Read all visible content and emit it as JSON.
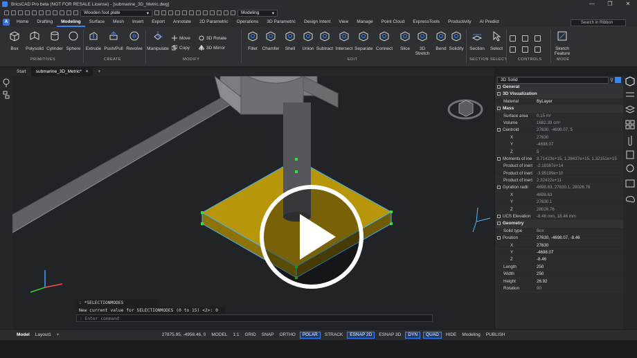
{
  "window": {
    "title": "BricsCAD Pro beta (NOT FOR RESALE License) - [submarine_3D_Metric.dwg]",
    "controls": [
      "—",
      "❐",
      "✕"
    ]
  },
  "qat": {
    "layer_value": "Wooden foot plate",
    "workspace_value": "Modeling"
  },
  "menu": {
    "app_button": "A",
    "items": [
      "Home",
      "Drafting",
      "Modeling",
      "Surface",
      "Mesh",
      "Insert",
      "Export",
      "Annotate",
      "2D Parametric",
      "Operations",
      "3D Parametric",
      "Design Intent",
      "View",
      "Manage",
      "Point Cloud",
      "ExpressTools",
      "Productivity",
      "AI Predict"
    ],
    "active": "Modeling",
    "search_placeholder": "Search in Ribbon"
  },
  "ribbon": {
    "primitives": [
      "Box",
      "Polysolid",
      "Cylinder",
      "Sphere"
    ],
    "create": [
      "Extrude",
      "Push/Pull",
      "Revolve"
    ],
    "modify_large": [
      "Manipulate"
    ],
    "modify_small": [
      "Move",
      "Copy",
      "3D Rotate",
      "3D Mirror"
    ],
    "edit": [
      "Fillet",
      "Chamfer",
      "Shell",
      "Union",
      "Subtract",
      "Intersect",
      "Separate",
      "Connect",
      "Slice",
      "3D Stretch",
      "Bend",
      "Solidify"
    ],
    "section": "Section",
    "select": "Select",
    "sketch": "Sketch Feature",
    "groups": {
      "primitives": "PRIMITIVES",
      "create": "CREATE",
      "modify": "MODIFY",
      "edit": "EDIT",
      "section": "SECTION",
      "select": "SELECT",
      "controls": "CONTROLS",
      "mode": "MODE"
    }
  },
  "doc_tabs": [
    "Start",
    "submarine_3D_Metric*"
  ],
  "doc_tab_add": "+",
  "command_line": {
    "line1": ": *SELECTIONMODES",
    "line2": "New current value for SELECTIONMODES (0 to 15) <2>: 0",
    "prompt": ": Enter command"
  },
  "properties": {
    "selector": "3D Solid",
    "sections": [
      {
        "name": "General",
        "rows": []
      },
      {
        "name": "3D Visualization",
        "rows": [
          {
            "k": "Material",
            "v": "ByLayer",
            "white": true
          }
        ]
      },
      {
        "name": "Mass",
        "rows": [
          {
            "k": "Surface area",
            "v": "0.15 m²"
          },
          {
            "k": "Volume",
            "v": "1682.39 cm³"
          },
          {
            "k": "Centroid",
            "v": "27630, -4698.07, 5",
            "box": true
          },
          {
            "k": "X",
            "v": "27630",
            "ind": true
          },
          {
            "k": "Y",
            "v": "-4698.07",
            "ind": true
          },
          {
            "k": "Z",
            "v": "5",
            "ind": true
          },
          {
            "k": "Moments of ine",
            "v": "3.71423e+15, 1.28437e+15, 1.32151e+15",
            "box": true
          },
          {
            "k": "Product of inert",
            "v": "-2.18387e+14"
          },
          {
            "k": "Product of inert",
            "v": "-3.95199e+10"
          },
          {
            "k": "Product of inert",
            "v": "2.32422e+11"
          },
          {
            "k": "Gyration radii",
            "v": "4698.63, 27630.1, 28026.76",
            "box": true
          },
          {
            "k": "X",
            "v": "4698.63",
            "ind": true
          },
          {
            "k": "Y",
            "v": "27630.1",
            "ind": true
          },
          {
            "k": "Z",
            "v": "28026.76",
            "ind": true
          },
          {
            "k": "UCS Elevation",
            "v": "-8.46 mm, 18.46 mm",
            "box": true
          }
        ]
      },
      {
        "name": "Geometry",
        "rows": [
          {
            "k": "Solid type",
            "v": "Box"
          },
          {
            "k": "Position",
            "v": "27630, -4698.07, -8.46",
            "white": true,
            "box": true
          },
          {
            "k": "X",
            "v": "27630",
            "ind": true,
            "white": true
          },
          {
            "k": "Y",
            "v": "-4698.07",
            "ind": true,
            "white": true
          },
          {
            "k": "Z",
            "v": "-8.46",
            "ind": true,
            "white": true
          },
          {
            "k": "Length",
            "v": "250",
            "white": true
          },
          {
            "k": "Width",
            "v": "250",
            "white": true
          },
          {
            "k": "Height",
            "v": "26.92",
            "white": true
          },
          {
            "k": "Rotation",
            "v": "90"
          }
        ]
      }
    ]
  },
  "status": {
    "layout_tabs": [
      "Model",
      "Layout1"
    ],
    "coords": "27875.95, -4958.46, 0",
    "items": [
      {
        "t": "MODEL",
        "on": false
      },
      {
        "t": "1:1",
        "on": false
      },
      {
        "t": "GRID",
        "on": false
      },
      {
        "t": "SNAP",
        "on": false
      },
      {
        "t": "ORTHO",
        "on": false
      },
      {
        "t": "POLAR",
        "on": true
      },
      {
        "t": "STRACK",
        "on": false
      },
      {
        "t": "ESNAP 2D",
        "on": true
      },
      {
        "t": "ESNAP 3D",
        "on": false
      },
      {
        "t": "DYN",
        "on": true
      },
      {
        "t": "QUAD",
        "on": true
      },
      {
        "t": "HIDE",
        "on": false
      },
      {
        "t": "Modeling",
        "on": false
      },
      {
        "t": "PUBLISH",
        "on": false
      }
    ]
  },
  "colors": {
    "accent": "#3b82f6",
    "plate": "#b8960a",
    "selection": "#3fb6ff",
    "grip": "#33e033"
  }
}
